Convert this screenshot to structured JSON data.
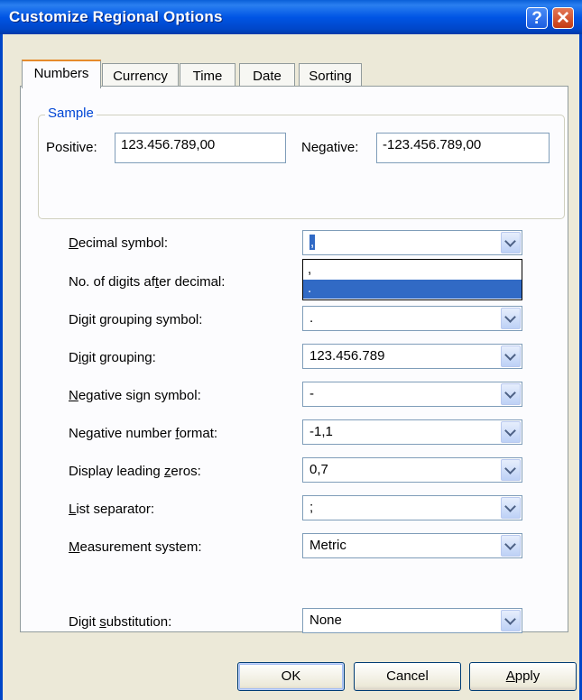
{
  "window": {
    "title": "Customize Regional Options",
    "help_glyph": "?",
    "close_glyph": "✕"
  },
  "tabs": [
    {
      "label": "Numbers",
      "active": true
    },
    {
      "label": "Currency",
      "active": false
    },
    {
      "label": "Time",
      "active": false
    },
    {
      "label": "Date",
      "active": false
    },
    {
      "label": "Sorting",
      "active": false
    }
  ],
  "sample": {
    "group_label": "Sample",
    "positive_label": "Positive:",
    "positive_value": "123.456.789,00",
    "negative_label": "Negative:",
    "negative_value": "-123.456.789,00"
  },
  "settings": [
    {
      "key": "decimal_symbol",
      "label_pre": "",
      "label_u": "D",
      "label_post": "ecimal symbol:",
      "value": ","
    },
    {
      "key": "digits_after_decimal",
      "label_pre": "No. of digits af",
      "label_u": "t",
      "label_post": "er decimal:",
      "value": ""
    },
    {
      "key": "digit_grouping_symbol",
      "label_pre": "Digit ",
      "label_u": "g",
      "label_post": "rouping symbol:",
      "value": "."
    },
    {
      "key": "digit_grouping",
      "label_pre": "D",
      "label_u": "i",
      "label_post": "git grouping:",
      "value": "123.456.789"
    },
    {
      "key": "negative_sign_symbol",
      "label_pre": "",
      "label_u": "N",
      "label_post": "egative sign symbol:",
      "value": "-"
    },
    {
      "key": "negative_number_format",
      "label_pre": "Negative number ",
      "label_u": "f",
      "label_post": "ormat:",
      "value": "-1,1"
    },
    {
      "key": "display_leading_zeros",
      "label_pre": "Display leading ",
      "label_u": "z",
      "label_post": "eros:",
      "value": "0,7"
    },
    {
      "key": "list_separator",
      "label_pre": "",
      "label_u": "L",
      "label_post": "ist separator:",
      "value": ";"
    },
    {
      "key": "measurement_system",
      "label_pre": "",
      "label_u": "M",
      "label_post": "easurement system:",
      "value": "Metric"
    },
    {
      "key": "digit_substitution",
      "label_pre": "Digit ",
      "label_u": "s",
      "label_post": "ubstitution:",
      "value": "None"
    }
  ],
  "decimal_dropdown": {
    "options": [
      ",",
      "."
    ],
    "highlighted_index": 1
  },
  "buttons": {
    "ok": "OK",
    "cancel": "Cancel",
    "apply_u": "A",
    "apply_rest": "pply"
  }
}
